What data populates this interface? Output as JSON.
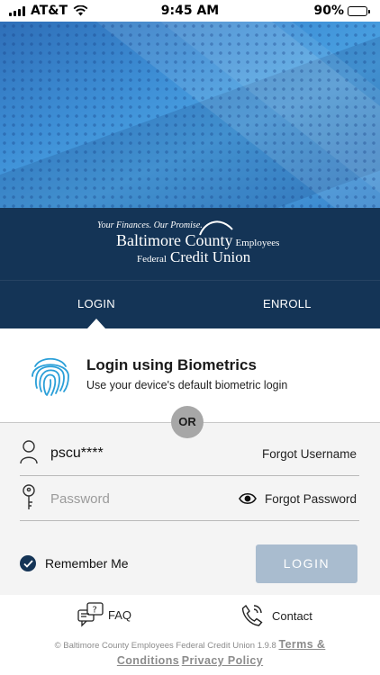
{
  "status_bar": {
    "carrier": "AT&T",
    "time": "9:45 AM",
    "battery": "90%",
    "battery_level": 0.9
  },
  "brand": {
    "tagline": "Your Finances. Our Promise.",
    "name_line1": "Baltimore County",
    "name_line1_suffix": "Employees",
    "name_line2_prefix": "Federal",
    "name_line2": "Credit Union",
    "colors": {
      "navy": "#143456",
      "hero_blue": "#3d8ed5"
    }
  },
  "tabs": [
    {
      "label": "LOGIN",
      "active": true
    },
    {
      "label": "ENROLL",
      "active": false
    }
  ],
  "biometrics": {
    "title": "Login using Biometrics",
    "subtitle": "Use your device's default biometric login",
    "icon": "fingerprint-icon"
  },
  "divider_label": "OR",
  "username": {
    "value": "pscu****",
    "forgot_label": "Forgot Username",
    "icon": "user-icon"
  },
  "password": {
    "placeholder": "Password",
    "forgot_label": "Forgot Password",
    "icon": "key-icon",
    "reveal_icon": "eye-icon"
  },
  "remember": {
    "label": "Remember Me",
    "checked": true
  },
  "login_button": {
    "label": "LOGIN",
    "color": "#a9bccf"
  },
  "footer": {
    "faq_label": "FAQ",
    "contact_label": "Contact",
    "copyright": "© Baltimore County Employees Federal Credit Union 1.9.8",
    "terms_label": "Terms & Conditions",
    "privacy_label": "Privacy Policy"
  }
}
